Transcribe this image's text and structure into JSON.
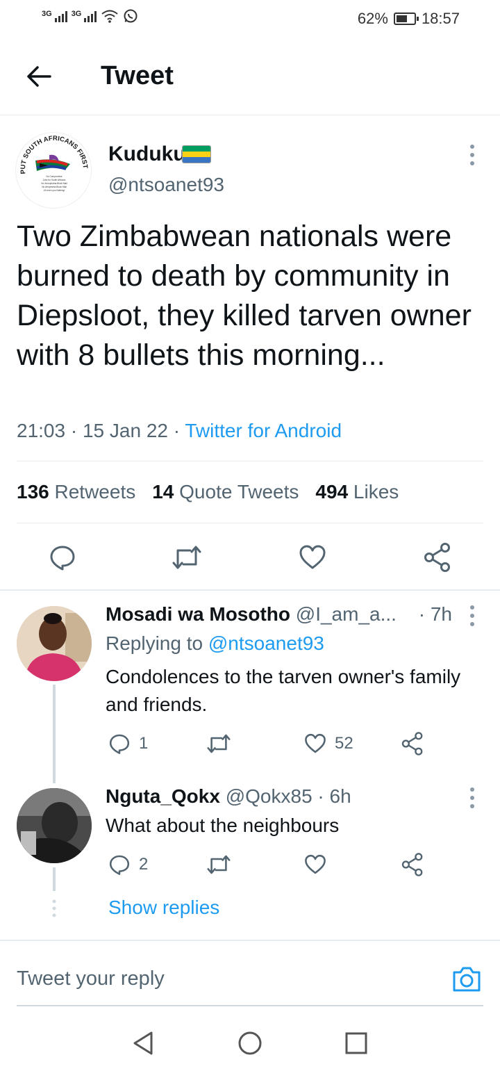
{
  "status_bar": {
    "signal_1": "3G",
    "signal_2": "3G",
    "battery_percent": "62%",
    "battery_level": 0.62,
    "time": "18:57"
  },
  "header": {
    "title": "Tweet"
  },
  "tweet": {
    "author_name": "Kuduku",
    "author_handle": "@ntsoanet93",
    "flag_colors": [
      "#009e60",
      "#fcd116",
      "#3a75c4"
    ],
    "avatar_text": {
      "arc": "PUT SOUTH AFRICANS FIRST",
      "lines": [
        "No Compromise",
        "Jobs for South Africans",
        "No Xenophobia Block Mall",
        "No Afrophobia Block Mall",
        "Uh even you Nothing!"
      ]
    },
    "text": "Two Zimbabwean nationals were burned to death by community in Diepsloot, they killed tarven owner with 8 bullets this morning...",
    "time": "21:03",
    "date": "15 Jan 22",
    "source": "Twitter for Android",
    "retweets_count": "136",
    "retweets_label": "Retweets",
    "quotes_count": "14",
    "quotes_label": "Quote Tweets",
    "likes_count": "494",
    "likes_label": "Likes"
  },
  "replies": [
    {
      "name": "Mosadi wa Mosotho",
      "handle": "@I_am_a...",
      "age": "· 7h",
      "replying_label": "Replying to",
      "replying_to": "@ntsoanet93",
      "text": "Condolences to the tarven owner's family and friends.",
      "reply_count": "1",
      "like_count": "52"
    },
    {
      "name": "Nguta_Qokx",
      "handle": "@Qokx85",
      "age": "· 6h",
      "text": "What about the neighbours",
      "reply_count": "2"
    }
  ],
  "show_replies": "Show replies",
  "composer": {
    "placeholder": "Tweet your reply"
  },
  "colors": {
    "accent": "#1d9bf0",
    "secondary_text": "#536471",
    "border": "#e6ecf0"
  }
}
